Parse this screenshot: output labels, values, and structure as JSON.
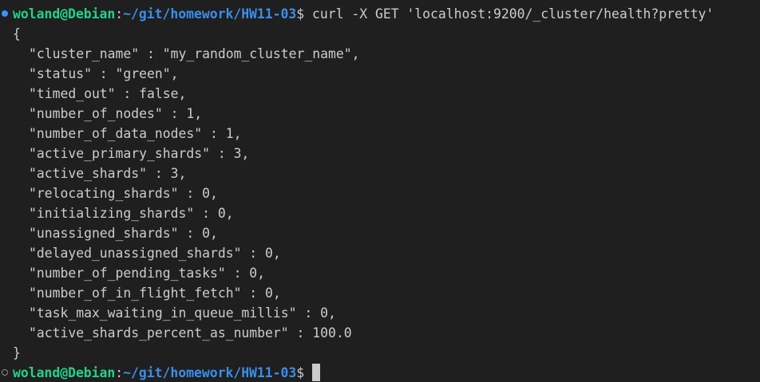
{
  "prompt": {
    "user_host": "woland@Debian",
    "separator": ":",
    "path": "~/git/homework/HW11-03",
    "symbol": "$"
  },
  "command": " curl -X GET 'localhost:9200/_cluster/health?pretty'",
  "output": {
    "open_brace": "{",
    "lines": [
      "\"cluster_name\" : \"my_random_cluster_name\",",
      "\"status\" : \"green\",",
      "\"timed_out\" : false,",
      "\"number_of_nodes\" : 1,",
      "\"number_of_data_nodes\" : 1,",
      "\"active_primary_shards\" : 3,",
      "\"active_shards\" : 3,",
      "\"relocating_shards\" : 0,",
      "\"initializing_shards\" : 0,",
      "\"unassigned_shards\" : 0,",
      "\"delayed_unassigned_shards\" : 0,",
      "\"number_of_pending_tasks\" : 0,",
      "\"number_of_in_flight_fetch\" : 0,",
      "\"task_max_waiting_in_queue_millis\" : 0,",
      "\"active_shards_percent_as_number\" : 100.0"
    ],
    "close_brace": "}"
  },
  "colors": {
    "background": "#1f1f1f",
    "prompt_user": "#23d18b",
    "prompt_path": "#3b8eea",
    "text": "#cccccc",
    "decoration_success": "#3794ff"
  }
}
